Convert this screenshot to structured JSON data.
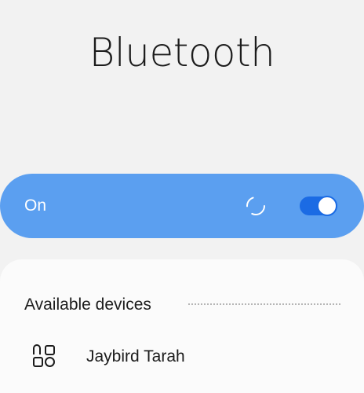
{
  "header": {
    "title": "Bluetooth"
  },
  "master_switch": {
    "label": "On",
    "enabled": true,
    "scanning": true,
    "accent_color": "#5b9ff0",
    "switch_color": "#1b6be4"
  },
  "available_devices": {
    "header": "Available devices",
    "devices": [
      {
        "name": "Jaybird Tarah",
        "icon": "device-apps-icon"
      }
    ]
  }
}
